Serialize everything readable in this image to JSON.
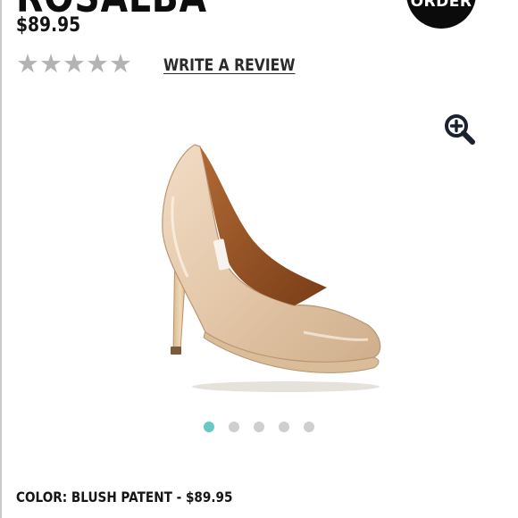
{
  "product": {
    "title": "ROSALBA",
    "price": "$89.95"
  },
  "order_badge": {
    "label": "ORDER"
  },
  "rating": {
    "stars_filled": 0,
    "stars_total": 5,
    "write_review_label": "WRITE A REVIEW",
    "star_color": "#b3b3b3"
  },
  "zoom": {
    "icon": "zoom-in-icon"
  },
  "gallery": {
    "image": "nude-patent-platform-pump",
    "image_count": 5,
    "active_index": 0,
    "active_dot_color": "#66c9c4",
    "inactive_dot_color": "#cfcfcf"
  },
  "selection": {
    "color_line": "COLOR: BLUSH PATENT - $89.95"
  }
}
